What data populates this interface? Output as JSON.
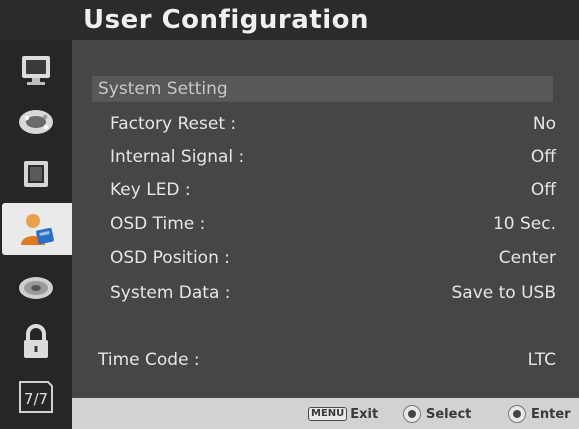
{
  "header": {
    "title": "User Configuration"
  },
  "sidebar": {
    "items": [
      {
        "icon": "monitor-icon"
      },
      {
        "icon": "color-palette-icon"
      },
      {
        "icon": "screen-icon"
      },
      {
        "icon": "user-icon",
        "active": true
      },
      {
        "icon": "disc-icon"
      },
      {
        "icon": "lock-icon"
      }
    ],
    "page": "7/7"
  },
  "section": {
    "title": "System Setting"
  },
  "settings": [
    {
      "label": "Factory Reset :",
      "value": "No"
    },
    {
      "label": "Internal Signal :",
      "value": "Off"
    },
    {
      "label": "Key LED :",
      "value": "Off"
    },
    {
      "label": "OSD Time :",
      "value": "10 Sec."
    },
    {
      "label": "OSD Position :",
      "value": "Center"
    },
    {
      "label": "System Data :",
      "value": "Save to USB"
    }
  ],
  "timecode": {
    "label": "Time Code :",
    "value": "LTC"
  },
  "footer": {
    "menu_key": "MENU",
    "exit_label": "Exit",
    "select_label": "Select",
    "enter_label": "Enter"
  }
}
